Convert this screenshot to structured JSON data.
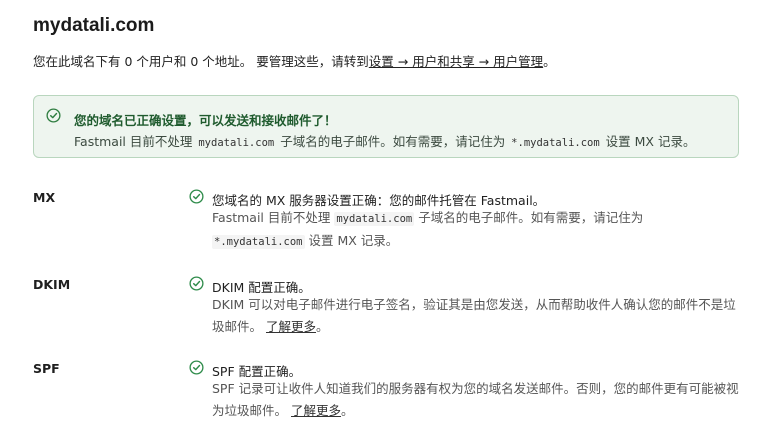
{
  "domain_title": "mydatali.com",
  "intro": {
    "prefix": "您在此域名下有 0 个用户和 0 个地址。 要管理这些，请转到",
    "link": "设置 → 用户和共享 → 用户管理",
    "suffix": "。"
  },
  "banner": {
    "title": "您的域名已正确设置，可以发送和接收邮件了！",
    "body_1": "Fastmail 目前不处理 ",
    "code_1": "mydatali.com",
    "body_2": " 子域名的电子邮件。如有需要，请记住为 ",
    "code_2": "*.mydatali.com",
    "body_3": " 设置 MX 记录。",
    "colors": {
      "background": "#eef5ef",
      "border": "#b9d6be",
      "title": "#1f5b2e"
    }
  },
  "records": {
    "mx": {
      "label": "MX",
      "status": "您域名的 MX 服务器设置正确：您的邮件托管在 Fastmail。",
      "body_1": "Fastmail 目前不处理 ",
      "code_1": "mydatali.com",
      "body_2": " 子域名的电子邮件。如有需要，请记住为",
      "code_2": "*.mydatali.com",
      "body_3": " 设置 MX 记录。"
    },
    "dkim": {
      "label": "DKIM",
      "status": "DKIM 配置正确。",
      "body": "DKIM 可以对电子邮件进行电子签名，验证其是由您发送，从而帮助收件人确认您的邮件不是垃圾邮件。",
      "link": "了解更多",
      "suffix": "。"
    },
    "spf": {
      "label": "SPF",
      "status": "SPF 配置正确。",
      "body": "SPF 记录可让收件人知道我们的服务器有权为您的域名发送邮件。否则，您的邮件更有可能被视为垃圾邮件。",
      "link": "了解更多",
      "suffix": "。"
    }
  },
  "icons": {
    "status": "check-circle-icon"
  },
  "accent_color": "#2e8b4a"
}
